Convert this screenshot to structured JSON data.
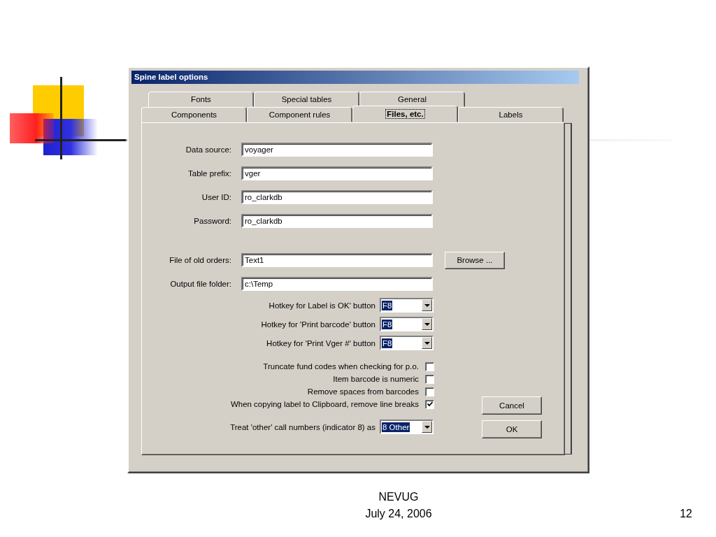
{
  "window": {
    "title": "Spine label options"
  },
  "tab_rows": [
    [
      {
        "label": "Fonts",
        "selected": false
      },
      {
        "label": "Special tables",
        "selected": false
      },
      {
        "label": "General",
        "selected": false
      }
    ],
    [
      {
        "label": "Components",
        "selected": false
      },
      {
        "label": "Component rules",
        "selected": false
      },
      {
        "label": "Files, etc.",
        "selected": true
      },
      {
        "label": "Labels",
        "selected": false
      }
    ]
  ],
  "connection_fields": [
    {
      "label": "Data source:",
      "value": "voyager"
    },
    {
      "label": "Table prefix:",
      "value": "vger"
    },
    {
      "label": "User ID:",
      "value": "ro_clarkdb"
    },
    {
      "label": "Password:",
      "value": "ro_clarkdb"
    }
  ],
  "file_fields": [
    {
      "label": "File of old orders:",
      "value": "Text1",
      "button": "Browse ..."
    },
    {
      "label": "Output file folder:",
      "value": "c:\\Temp"
    }
  ],
  "hotkeys": [
    {
      "label": "Hotkey for Label is OK' button",
      "value": "F8"
    },
    {
      "label": "Hotkey for 'Print barcode' button",
      "value": "F8"
    },
    {
      "label": "Hotkey for 'Print Vger #' button",
      "value": "F8"
    }
  ],
  "options": [
    {
      "label": "Truncate fund codes when checking for p.o.",
      "checked": false
    },
    {
      "label": "Item barcode is numeric",
      "checked": false
    },
    {
      "label": "Remove spaces from barcodes",
      "checked": false
    },
    {
      "label": "When copying label to Clipboard, remove line breaks",
      "checked": true
    }
  ],
  "call_number_setting": {
    "label": "Treat 'other' call numbers (indicator 8) as",
    "value": "8 Other"
  },
  "buttons": [
    "Cancel",
    "OK"
  ],
  "slide": {
    "footer_title": "NEVUG",
    "footer_date": "July 24, 2006",
    "page_number": "12"
  }
}
